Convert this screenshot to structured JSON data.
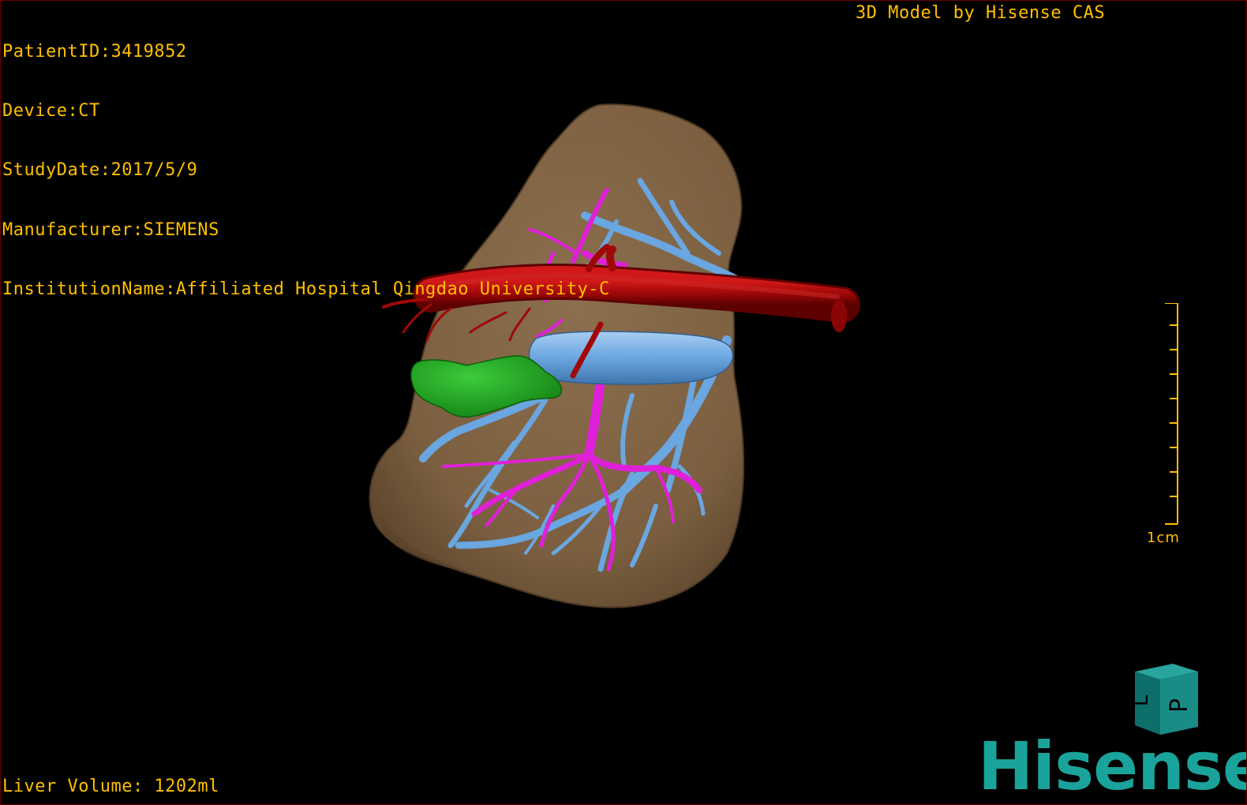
{
  "header": {
    "patient_id": "PatientID:3419852",
    "device": "Device:CT",
    "study_date": "StudyDate:2017/5/9",
    "manufacturer": "Manufacturer:SIEMENS",
    "institution": "InstitutionName:Affiliated Hospital Qingdao University-C",
    "model_credit": "3D Model by Hisense CAS"
  },
  "footer": {
    "liver_volume": "Liver Volume: 1202ml"
  },
  "scale": {
    "label": "1cm"
  },
  "orientation_cube": {
    "face_top": "L",
    "face_front": "P"
  },
  "logo": {
    "text": "Hisense"
  },
  "colors": {
    "overlay_text": "#ffc000",
    "liver": "#8b6f4e",
    "artery": "#a00808",
    "portal_vein": "#6aa6e0",
    "hepatic_vein": "#e020d8",
    "lesion": "#1fa81f",
    "logo": "#1aa39a"
  }
}
